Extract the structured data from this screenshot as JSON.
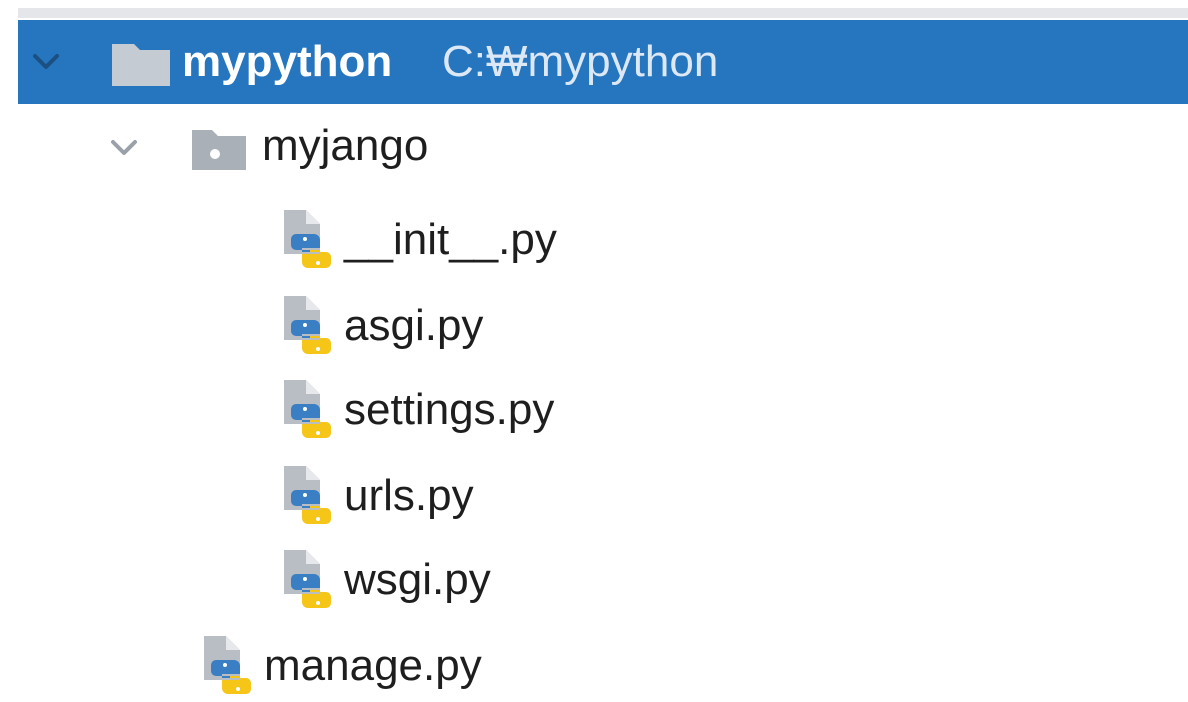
{
  "colors": {
    "selection": "#2675bf",
    "folder_on_selection": "#c5cbd2",
    "folder": "#a9b0b8",
    "chevron": "#9aa1a9",
    "python_blue": "#3a7ec4",
    "python_yellow": "#f5c518"
  },
  "tree": {
    "root": {
      "name": "mypython",
      "path": "C:₩mypython",
      "icon": "folder-icon",
      "expanded": true
    },
    "package": {
      "name": "myjango",
      "icon": "package-folder-icon",
      "expanded": true,
      "files": [
        {
          "name": "__init__.py",
          "icon": "python-file-icon"
        },
        {
          "name": "asgi.py",
          "icon": "python-file-icon"
        },
        {
          "name": "settings.py",
          "icon": "python-file-icon"
        },
        {
          "name": "urls.py",
          "icon": "python-file-icon"
        },
        {
          "name": "wsgi.py",
          "icon": "python-file-icon"
        }
      ]
    },
    "root_files": [
      {
        "name": "manage.py",
        "icon": "python-file-icon"
      }
    ]
  }
}
